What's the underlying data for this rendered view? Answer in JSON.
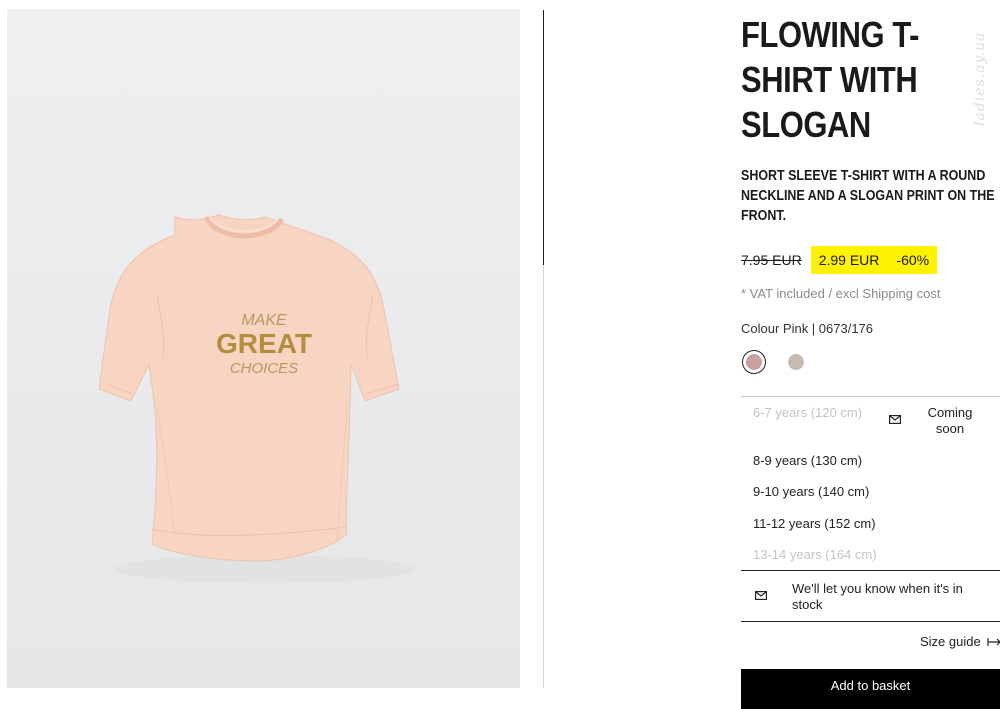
{
  "product": {
    "title": "FLOWING T-SHIRT WITH SLOGAN",
    "description": "SHORT SLEEVE T-SHIRT WITH A ROUND NECKLINE AND A SLOGAN PRINT ON THE FRONT.",
    "image_print": [
      "MAKE",
      "GREAT",
      "CHOICES"
    ],
    "watermark": "ladies.ay.ua"
  },
  "pricing": {
    "old_price": "7.95 EUR",
    "sale_price": "2.99 EUR",
    "discount": "-60%",
    "vat_note": "* VAT included / excl Shipping cost",
    "highlight_color": "#fff200"
  },
  "colour": {
    "label": "Colour Pink | 0673/176",
    "swatches": [
      {
        "name": "Pink",
        "hex": "#c9a0a0",
        "selected": true
      },
      {
        "name": "Beige",
        "hex": "#c8bbb4",
        "selected": false
      }
    ]
  },
  "sizes": [
    {
      "label": "6-7 years (120 cm)",
      "available": false,
      "status": "Coming soon",
      "icon": "envelope-icon"
    },
    {
      "label": "8-9 years (130 cm)",
      "available": true
    },
    {
      "label": "9-10 years (140 cm)",
      "available": true
    },
    {
      "label": "11-12 years (152 cm)",
      "available": true
    },
    {
      "label": "13-14 years (164 cm)",
      "available": false
    }
  ],
  "notify": {
    "text": "We'll let you know when it's in stock",
    "icon": "envelope-icon"
  },
  "size_guide": {
    "label": "Size guide",
    "icon": "ruler-icon"
  },
  "add_button": {
    "label": "Add to basket"
  }
}
